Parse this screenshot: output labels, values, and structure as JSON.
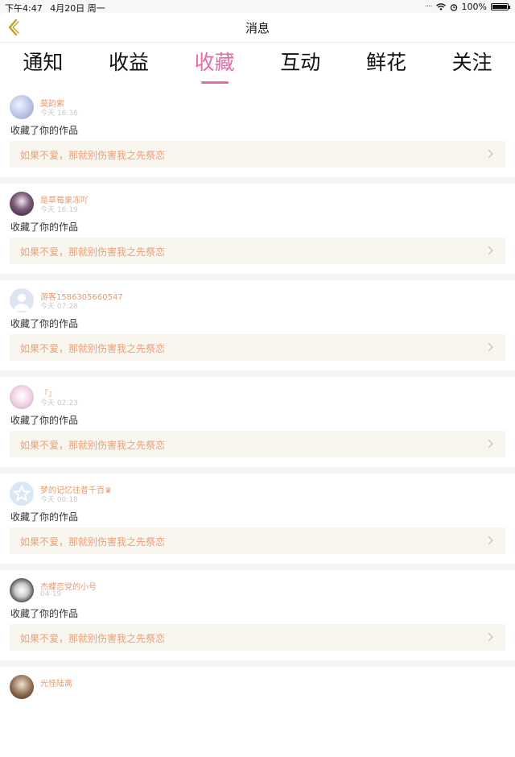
{
  "status": {
    "time": "下午4:47",
    "date": "4月20日 周一",
    "battery": "100%"
  },
  "nav": {
    "title": "消息"
  },
  "tabs": [
    {
      "label": "通知"
    },
    {
      "label": "收益"
    },
    {
      "label": "收藏"
    },
    {
      "label": "互动"
    },
    {
      "label": "鲜花"
    },
    {
      "label": "关注"
    }
  ],
  "active_tab": "收藏",
  "items": [
    {
      "user": "莫韵紫",
      "time": "今天 16:36",
      "action": "收藏了你的作品",
      "work": "如果不爱，那就别伤害我之先祭恋"
    },
    {
      "user": "是草莓果冻吖",
      "time": "今天 16:19",
      "action": "收藏了你的作品",
      "work": "如果不爱，那就别伤害我之先祭恋"
    },
    {
      "user": "游客1586305660547",
      "time": "今天 07:28",
      "action": "收藏了你的作品",
      "work": "如果不爱，那就别伤害我之先祭恋"
    },
    {
      "user": "『』",
      "time": "今天 02:23",
      "action": "收藏了你的作品",
      "work": "如果不爱，那就别伤害我之先祭恋"
    },
    {
      "user": "梦的记忆往昔千百♛",
      "time": "今天 00:18",
      "action": "收藏了你的作品",
      "work": "如果不爱，那就别伤害我之先祭恋"
    },
    {
      "user": "杰蝶恋党的小号",
      "time": "04-19",
      "action": "收藏了你的作品",
      "work": "如果不爱，那就别伤害我之先祭恋"
    },
    {
      "user": "光怪陆离",
      "time": "",
      "action": "",
      "work": ""
    }
  ],
  "colors": {
    "accent": "#e66aa8",
    "username": "#e59a6e",
    "work_bg": "#f8f6ee",
    "work_text": "#e8a07a"
  }
}
